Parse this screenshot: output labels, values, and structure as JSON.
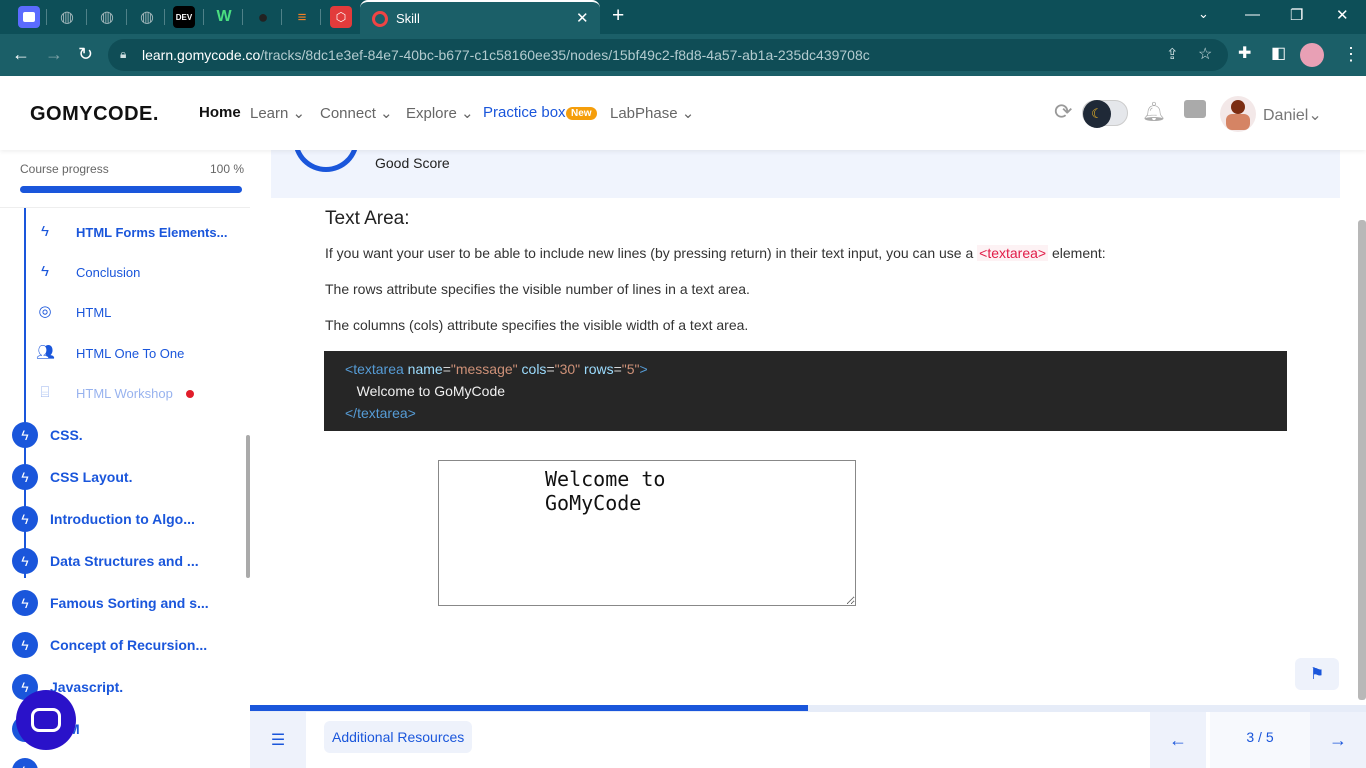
{
  "browser": {
    "active_tab_title": "Skill",
    "url_host": "learn.gomycode.co",
    "url_path": "/tracks/8dc1e3ef-84e7-40bc-b677-c1c58160ee35/nodes/15bf49c2-f8d8-4a57-ab1a-235dc439708c",
    "tab_icons": [
      "app-icon",
      "globe-icon",
      "globe-icon",
      "globe-icon",
      "dev-icon",
      "webflow-icon",
      "github-icon",
      "stackoverflow-icon",
      "gomycode-icon"
    ]
  },
  "header": {
    "logo": "GOMYCODE.",
    "nav": {
      "home": "Home",
      "learn": "Learn",
      "connect": "Connect",
      "explore": "Explore",
      "practice": "Practice box",
      "practice_badge": "New",
      "labphase": "LabPhase"
    },
    "username": "Daniel",
    "accent": "#1a56db"
  },
  "sidebar": {
    "progress_label": "Course progress",
    "progress_pct": "100 %",
    "progress_value": 1.0,
    "sub_items": [
      {
        "label": "HTML Forms Elements...",
        "icon": "bolt-icon"
      },
      {
        "label": "Conclusion",
        "icon": "bolt-icon"
      },
      {
        "label": "HTML",
        "icon": "target-icon"
      },
      {
        "label": "HTML One To One",
        "icon": "people-icon"
      },
      {
        "label": "HTML Workshop",
        "icon": "workshop-icon"
      }
    ],
    "chapters": [
      {
        "label": "CSS."
      },
      {
        "label": "CSS Layout."
      },
      {
        "label": "Introduction to Algo..."
      },
      {
        "label": "Data Structures and ..."
      },
      {
        "label": "Famous Sorting and s..."
      },
      {
        "label": "Concept of Recursion..."
      },
      {
        "label": "Javascript."
      },
      {
        "label": "M"
      }
    ]
  },
  "main": {
    "score_text": "Good Score",
    "section_title": "Text Area:",
    "para1_before": "If you want your user to be able to include new lines (by pressing return) in their text input, you can use a ",
    "para1_code": "<textarea>",
    "para1_after": " element:",
    "para2": "The rows attribute specifies the visible number of lines in a text area.",
    "para3": "The columns (cols) attribute specifies the visible width of a text area.",
    "code": {
      "open_lt": "<",
      "tag": "textarea",
      "attr1": "name",
      "val1": "\"message\"",
      "attr2": "cols",
      "val2": "\"30\"",
      "attr3": "rows",
      "val3": "\"5\"",
      "open_gt": ">",
      "content": "Welcome to GoMyCode",
      "close_lt": "</",
      "close_gt": ">"
    },
    "demo_value": "Welcome to GoMyCode"
  },
  "bottom": {
    "progress_value": 0.5,
    "resources": "Additional Resources",
    "counter": "3 / 5"
  }
}
